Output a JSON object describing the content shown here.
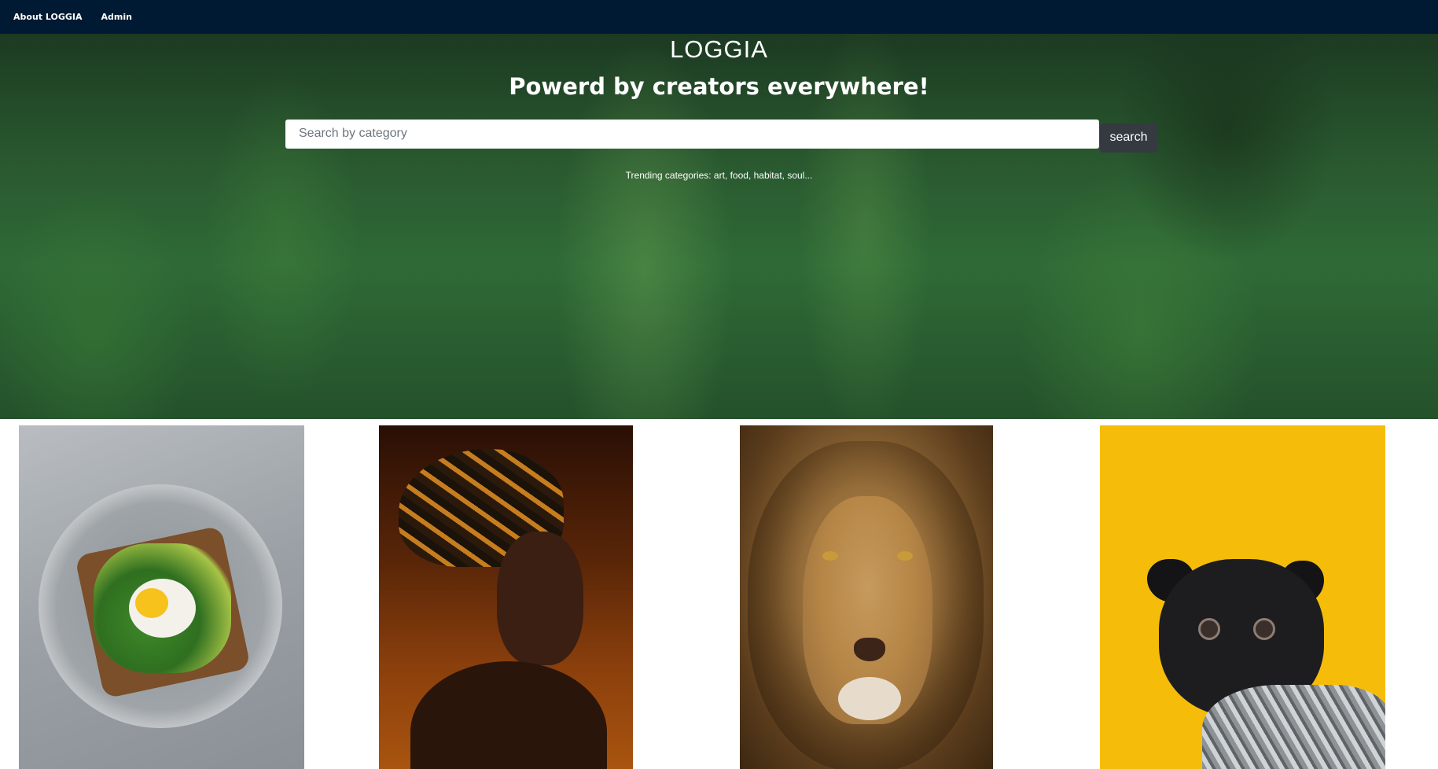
{
  "nav": {
    "about_label": "About LOGGIA",
    "admin_label": "Admin"
  },
  "hero": {
    "brand": "LOGGIA",
    "tagline": "Powerd by creators everywhere!",
    "search_placeholder": "Search by category",
    "search_value": "",
    "search_button_label": "search",
    "trending_text": "Trending categories: art, food, habitat, soul..."
  },
  "gallery": {
    "photos": [
      {
        "subject": "avocado toast with poached egg on grey plate"
      },
      {
        "subject": "woman wearing patterned head wrap"
      },
      {
        "subject": "lion face close-up"
      },
      {
        "subject": "black pug in grey sweater on yellow background"
      }
    ]
  },
  "colors": {
    "navbar": "#001a33",
    "search_button": "#343a40",
    "pug_background": "#f5bd0a"
  }
}
